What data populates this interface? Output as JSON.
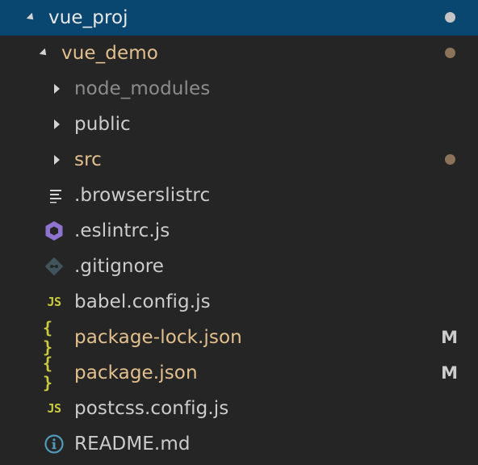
{
  "colors": {
    "background": "#252526",
    "selected_row": "#094771",
    "default_text": "#cccccc",
    "modified_text": "#e2c08d",
    "ignored_text": "#8c8c8c",
    "modified_dot_root": "#c5c5c5",
    "modified_dot": "#8a7358",
    "git_modified_badge": "#cccccc"
  },
  "tree": {
    "root": {
      "label": "vue_proj",
      "expanded": true,
      "decoration": "modified-dot"
    },
    "project": {
      "label": "vue_demo",
      "expanded": true,
      "decoration": "modified-dot"
    },
    "folders": [
      {
        "label": "node_modules",
        "expanded": false,
        "status": "ignored"
      },
      {
        "label": "public",
        "expanded": false,
        "status": "none"
      },
      {
        "label": "src",
        "expanded": false,
        "status": "modified",
        "decoration": "modified-dot"
      }
    ],
    "files": [
      {
        "label": ".browserslistrc",
        "icon": "text-lines-icon",
        "status": "none",
        "badge": ""
      },
      {
        "label": ".eslintrc.js",
        "icon": "eslint-icon",
        "status": "none",
        "badge": ""
      },
      {
        "label": ".gitignore",
        "icon": "git-icon",
        "status": "none",
        "badge": ""
      },
      {
        "label": "babel.config.js",
        "icon": "js-icon",
        "status": "none",
        "badge": ""
      },
      {
        "label": "package-lock.json",
        "icon": "json-icon",
        "status": "modified",
        "badge": "M"
      },
      {
        "label": "package.json",
        "icon": "json-icon",
        "status": "modified",
        "badge": "M"
      },
      {
        "label": "postcss.config.js",
        "icon": "js-icon",
        "status": "none",
        "badge": ""
      },
      {
        "label": "README.md",
        "icon": "info-icon",
        "status": "none",
        "badge": ""
      }
    ],
    "icon_glyphs": {
      "js": "JS",
      "json": "{ }"
    }
  }
}
